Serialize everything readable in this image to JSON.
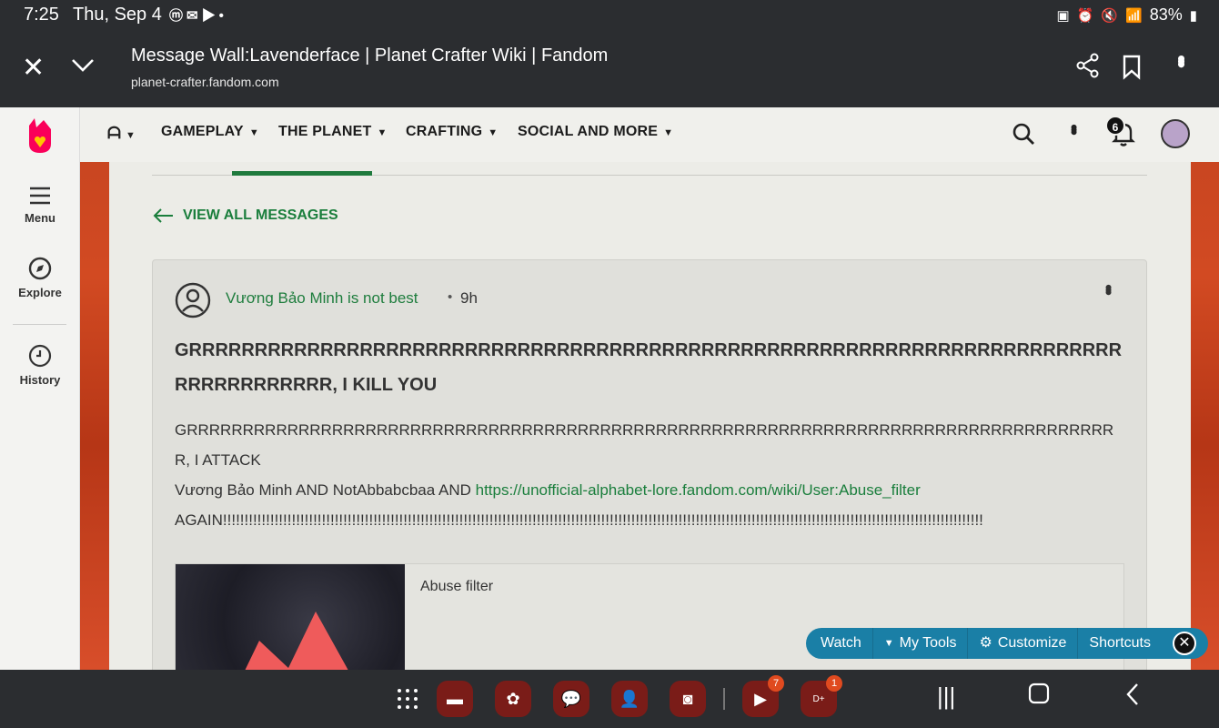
{
  "status_bar": {
    "time": "7:25",
    "date": "Thu, Sep 4",
    "notification_icons": [
      "m-icon",
      "gmail-icon",
      "youtube-icon",
      "dot"
    ],
    "battery": "83%"
  },
  "browser": {
    "page_title": "Message Wall:Lavenderface | Planet Crafter Wiki | Fandom",
    "url": "planet-crafter.fandom.com"
  },
  "left_rail": {
    "menu_label": "Menu",
    "explore_label": "Explore",
    "history_label": "History"
  },
  "wiki_nav": {
    "items": [
      {
        "label": "GAMEPLAY"
      },
      {
        "label": "THE PLANET"
      },
      {
        "label": "CRAFTING"
      },
      {
        "label": "SOCIAL AND MORE"
      }
    ],
    "notification_count": "6"
  },
  "content": {
    "view_all_label": "VIEW ALL MESSAGES",
    "post": {
      "author": "Vương Bảo Minh is not best",
      "separator": "•",
      "age": "9h",
      "title": "GRRRRRRRRRRRRRRRRRRRRRRRRRRRRRRRRRRRRRRRRRRRRRRRRRRRRRRRRRRRRRRRRRRRRRRRRRRRRRRRRRRR, I KILL YOU",
      "body_line1": "GRRRRRRRRRRRRRRRRRRRRRRRRRRRRRRRRRRRRRRRRRRRRRRRRRRRRRRRRRRRRRRRRRRRRRRRRRRRRRRRRRRRR, I ATTACK",
      "body_line2_prefix": "Vương Bảo Minh AND NotAbbabcbaa AND ",
      "body_link": "https://unofficial-alphabet-lore.fandom.com/wiki/User:Abuse_filter",
      "body_line3": "AGAIN!!!!!!!!!!!!!!!!!!!!!!!!!!!!!!!!!!!!!!!!!!!!!!!!!!!!!!!!!!!!!!!!!!!!!!!!!!!!!!!!!!!!!!!!!!!!!!!!!!!!!!!!!!!!!!!!!!!!!!!!!!!!!!!!!!!!!!!!!!!!!!!!!!!!!!!!!!!!!!!!!!!!!!!!!!!!!!!!!",
      "link_preview_title": "Abuse filter"
    }
  },
  "toolbar": {
    "watch": "Watch",
    "my_tools": "My Tools",
    "customize": "Customize",
    "shortcuts": "Shortcuts"
  },
  "taskbar": {
    "youtube_badge": "7",
    "disney_badge": "1"
  },
  "colors": {
    "accent_green": "#1a7e3c",
    "fandom_pink": "#fa005a",
    "toolbar_blue": "#1a7fa6"
  }
}
